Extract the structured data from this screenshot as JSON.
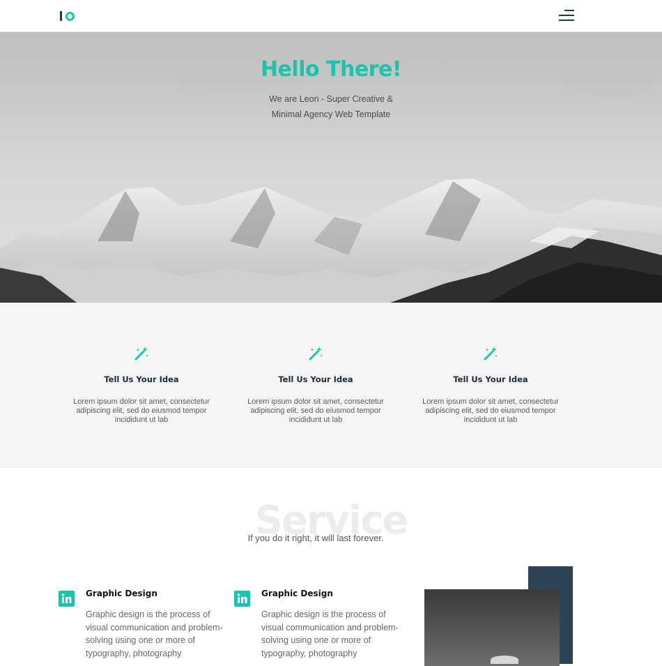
{
  "header": {
    "logo_name": "logo",
    "menu_icon": "hamburger-menu-icon"
  },
  "hero": {
    "title": "Hello There!",
    "subtitle_line1": "We are Leon - Super Creative &",
    "subtitle_line2": "Minimal Agency Web Template"
  },
  "features": [
    {
      "icon": "magic-wand-icon",
      "title": "Tell Us Your Idea",
      "text": "Lorem ipsum dolor sit amet, consectetur adipiscing elit, sed do eiusmod tempor incididunt ut lab"
    },
    {
      "icon": "magic-wand-icon",
      "title": "Tell Us Your Idea",
      "text": "Lorem ipsum dolor sit amet, consectetur adipiscing elit, sed do eiusmod tempor incididunt ut lab"
    },
    {
      "icon": "magic-wand-icon",
      "title": "Tell Us Your Idea",
      "text": "Lorem ipsum dolor sit amet, consectetur adipiscing elit, sed do eiusmod tempor incididunt ut lab"
    }
  ],
  "service": {
    "background_word": "Service",
    "tagline": "If you do it right, it will last forever.",
    "items": [
      {
        "icon": "linkedin-icon",
        "title": "Graphic Design",
        "text": "Graphic design is the process of visual communication and problem-solving using one or more of typography, photography"
      },
      {
        "icon": "linkedin-icon",
        "title": "Graphic Design",
        "text": "Graphic design is the process of visual communication and problem-solving using one or more of typography, photography"
      }
    ]
  },
  "colors": {
    "accent": "#19c4ad",
    "dark": "#2c4455",
    "feature_bg": "#f5f5f5"
  }
}
